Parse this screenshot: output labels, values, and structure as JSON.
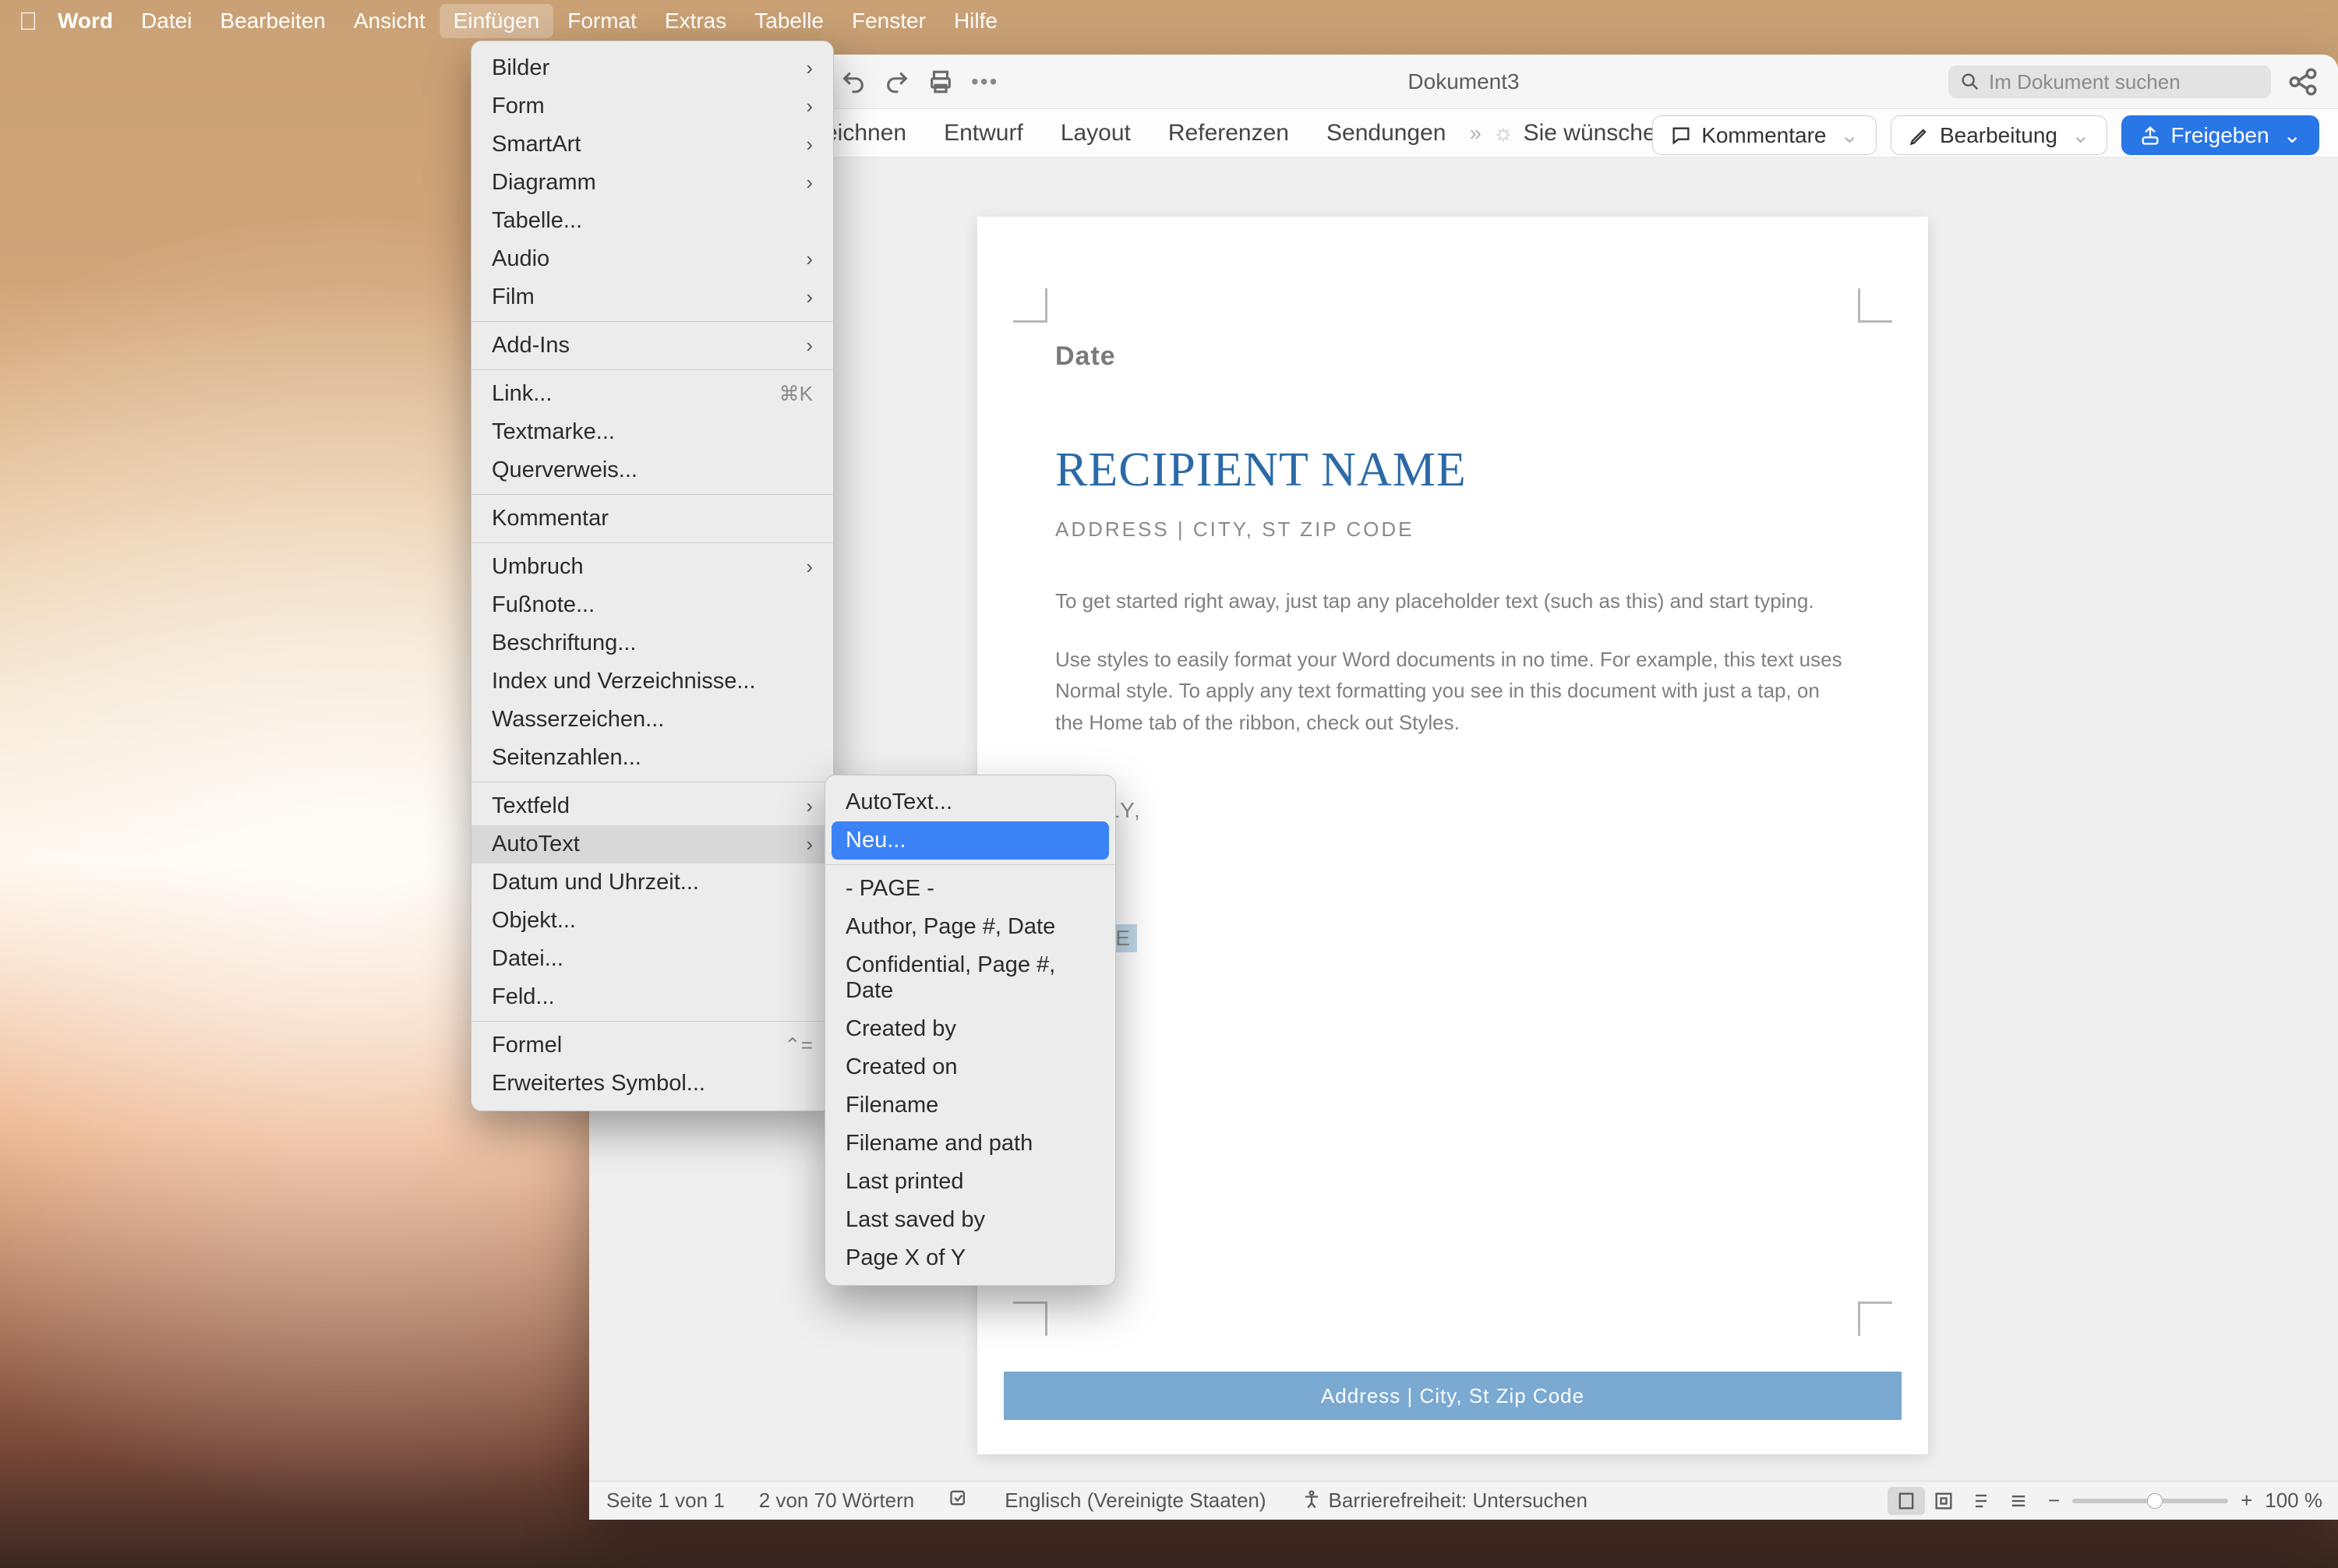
{
  "menubar": {
    "app": "Word",
    "items": [
      "Datei",
      "Bearbeiten",
      "Ansicht",
      "Einfügen",
      "Format",
      "Extras",
      "Tabelle",
      "Fenster",
      "Hilfe"
    ],
    "active_index": 3
  },
  "window": {
    "title": "Dokument3",
    "search_placeholder": "Im Dokument suchen"
  },
  "ribbon": {
    "tabs": [
      "eichnen",
      "Entwurf",
      "Layout",
      "Referenzen",
      "Sendungen"
    ],
    "wish": "Sie wünschen",
    "comments": "Kommentare",
    "edit": "Bearbeitung",
    "share": "Freigeben"
  },
  "doc": {
    "date": "Date",
    "recipient": "RECIPIENT NAME",
    "address": "ADDRESS | CITY, ST ZIP CODE",
    "p1": "To get started right away, just tap any placeholder text (such as this) and start typing.",
    "p2": "Use styles to easily format your Word documents in no time. For example, this text uses Normal style. To apply any text formatting you see in this document with just a tap, on the Home tab of the ribbon, check out Styles.",
    "sincerely": "ERELY,",
    "yourname": "NAME",
    "footer": "Address | City, St Zip Code"
  },
  "status": {
    "page": "Seite 1 von 1",
    "words": "2 von 70 Wörtern",
    "lang": "Englisch (Vereinigte Staaten)",
    "a11y": "Barrierefreiheit: Untersuchen",
    "zoom": "100 %"
  },
  "menu_insert": {
    "groups": [
      [
        {
          "label": "Bilder",
          "sub": true
        },
        {
          "label": "Form",
          "sub": true
        },
        {
          "label": "SmartArt",
          "sub": true
        },
        {
          "label": "Diagramm",
          "sub": true
        },
        {
          "label": "Tabelle..."
        },
        {
          "label": "Audio",
          "sub": true
        },
        {
          "label": "Film",
          "sub": true
        }
      ],
      [
        {
          "label": "Add-Ins",
          "sub": true
        }
      ],
      [
        {
          "label": "Link...",
          "shortcut": "⌘K"
        },
        {
          "label": "Textmarke..."
        },
        {
          "label": "Querverweis..."
        }
      ],
      [
        {
          "label": "Kommentar"
        }
      ],
      [
        {
          "label": "Umbruch",
          "sub": true
        },
        {
          "label": "Fußnote..."
        },
        {
          "label": "Beschriftung..."
        },
        {
          "label": "Index und Verzeichnisse..."
        },
        {
          "label": "Wasserzeichen..."
        },
        {
          "label": "Seitenzahlen..."
        }
      ],
      [
        {
          "label": "Textfeld",
          "sub": true
        },
        {
          "label": "AutoText",
          "sub": true,
          "hover": true
        },
        {
          "label": "Datum und Uhrzeit..."
        },
        {
          "label": "Objekt..."
        },
        {
          "label": "Datei..."
        },
        {
          "label": "Feld..."
        }
      ],
      [
        {
          "label": "Formel",
          "shortcut": "⌃="
        },
        {
          "label": "Erweitertes Symbol..."
        }
      ]
    ]
  },
  "menu_autotext": {
    "items": [
      {
        "label": "AutoText..."
      },
      {
        "label": "Neu...",
        "selected": true
      },
      {
        "sep": true
      },
      {
        "label": "- PAGE -"
      },
      {
        "label": "Author, Page #, Date"
      },
      {
        "label": "Confidential, Page #, Date"
      },
      {
        "label": "Created by"
      },
      {
        "label": "Created on"
      },
      {
        "label": "Filename"
      },
      {
        "label": "Filename and path"
      },
      {
        "label": "Last printed"
      },
      {
        "label": "Last saved by"
      },
      {
        "label": "Page X of Y"
      }
    ]
  }
}
